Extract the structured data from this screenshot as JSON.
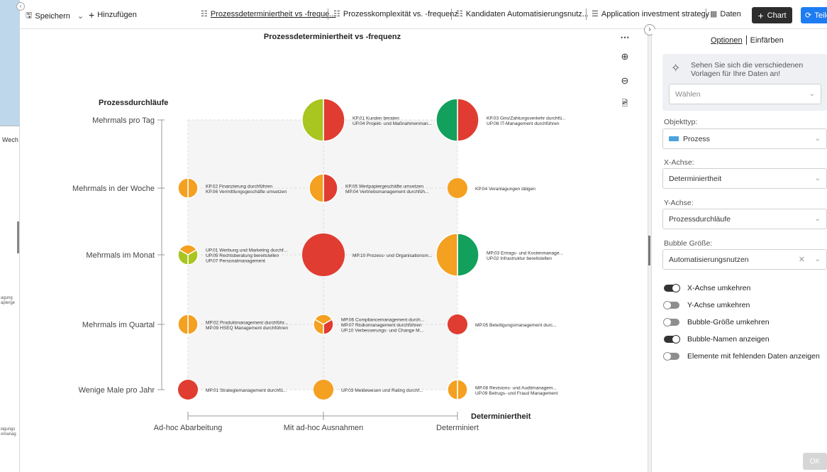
{
  "background_app": {
    "tab_fragment": "Wech",
    "fragments": [
      {
        "lines": [
          "agung",
          "apierge"
        ],
        "top": 0
      },
      {
        "lines": [
          "iligungs",
          "omanag"
        ],
        "top": 0
      }
    ]
  },
  "toolbar": {
    "save_label": "Speichern",
    "add_label": "Hinzufügen",
    "tabs": [
      {
        "label": "Prozessdeterminiertheit vs -freque..."
      },
      {
        "label": "Prozesskomplexität vs. -frequenz"
      },
      {
        "label": "Kandidaten Automatisierungsnutz..."
      },
      {
        "label": "Application investment strategy"
      }
    ],
    "data_label": "Daten",
    "chart_button": "Chart",
    "share_button": "Teilen"
  },
  "chart_data": {
    "type": "bubble",
    "title": "Prozessdeterminiertheit vs -frequenz",
    "ylabel": "Prozessdurchläufe",
    "xlabel": "Determiniertheit",
    "x_categories": [
      "Ad-hoc Abarbeitung",
      "Mit ad-hoc Ausnahmen",
      "Determiniert"
    ],
    "y_categories": [
      "Wenige Male pro Jahr",
      "Mehrmals im Quartal",
      "Mehrmals im Monat",
      "Mehrmals in der Woche",
      "Mehrmals pro Tag"
    ],
    "bubbles": [
      {
        "x": 1,
        "y": 4,
        "size": 3,
        "slices": [
          {
            "color": "#e03c31",
            "value": 1
          },
          {
            "color": "#a8c520",
            "value": 1
          }
        ],
        "labels": [
          "KP.01 Kunden beraten",
          "UP.04 Projekt- und Maßnahmenman..."
        ]
      },
      {
        "x": 2,
        "y": 4,
        "size": 3,
        "slices": [
          {
            "color": "#e03c31",
            "value": 1
          },
          {
            "color": "#12a05c",
            "value": 1
          }
        ],
        "labels": [
          "KP.03 Giro/Zahlungsverkehr durchfü...",
          "UP.08 IT-Management durchführen"
        ]
      },
      {
        "x": 0,
        "y": 3,
        "size": 1,
        "slices": [
          {
            "color": "#f4a020",
            "value": 1
          },
          {
            "color": "#f4a020",
            "value": 1
          }
        ],
        "labels": [
          "KP.02 Finanzierung durchführen",
          "KP.06 Vermittlungsgeschäfte umsetzen"
        ]
      },
      {
        "x": 1,
        "y": 3,
        "size": 2,
        "slices": [
          {
            "color": "#e03c31",
            "value": 1
          },
          {
            "color": "#f4a020",
            "value": 1
          }
        ],
        "labels": [
          "KP.05 Wertpapiergeschäfte umsetzen",
          "MP.04 Vertriebsmanagement durchfüh..."
        ]
      },
      {
        "x": 2,
        "y": 3,
        "size": 1,
        "slices": [
          {
            "color": "#f4a020",
            "value": 1
          }
        ],
        "labels": [
          "KP.04 Veranlagungen tätigen"
        ]
      },
      {
        "x": 0,
        "y": 2,
        "size": 1,
        "slices": [
          {
            "color": "#f4a020",
            "value": 1
          },
          {
            "color": "#a8c520",
            "value": 1
          },
          {
            "color": "#a8c520",
            "value": 1
          }
        ],
        "labels": [
          "UP.01 Werbung und Marketing durchf...",
          "UP.05 Rechtsberatung bereitstellen",
          "UP.07 Personalmanagement"
        ]
      },
      {
        "x": 1,
        "y": 2,
        "size": 3,
        "slices": [
          {
            "color": "#e03c31",
            "value": 1
          }
        ],
        "labels": [
          "MP.10 Prozess- und Organisationsm..."
        ]
      },
      {
        "x": 2,
        "y": 2,
        "size": 3,
        "slices": [
          {
            "color": "#12a05c",
            "value": 1
          },
          {
            "color": "#f4a020",
            "value": 1
          }
        ],
        "labels": [
          "MP.03 Ertrags- und Kostenmanage...",
          "UP.02 Infrastruktur bereitstellen"
        ]
      },
      {
        "x": 0,
        "y": 1,
        "size": 1,
        "slices": [
          {
            "color": "#f4a020",
            "value": 1
          },
          {
            "color": "#f4a020",
            "value": 1
          }
        ],
        "labels": [
          "MP.02 Produktmanagement durchführ...",
          "MP.09 HSEQ Management durchführen"
        ]
      },
      {
        "x": 1,
        "y": 1,
        "size": 1,
        "slices": [
          {
            "color": "#f4a020",
            "value": 1
          },
          {
            "color": "#e03c31",
            "value": 1
          },
          {
            "color": "#f4a020",
            "value": 1
          }
        ],
        "labels": [
          "MP.06 Compliancemanagement durch...",
          "MP.07 Risikomanagement durchführen",
          "UP.10 Verbesserungs- und Change M..."
        ]
      },
      {
        "x": 2,
        "y": 1,
        "size": 1,
        "slices": [
          {
            "color": "#e03c31",
            "value": 1
          }
        ],
        "labels": [
          "MP.05 Beteiligungsmanagement durc..."
        ]
      },
      {
        "x": 0,
        "y": 0,
        "size": 1,
        "slices": [
          {
            "color": "#e03c31",
            "value": 1
          }
        ],
        "labels": [
          "MP.01 Strategiemanagement durchfü..."
        ]
      },
      {
        "x": 1,
        "y": 0,
        "size": 1,
        "slices": [
          {
            "color": "#f4a020",
            "value": 1
          }
        ],
        "labels": [
          "UP.03 Meldewesen und Rating durchf..."
        ]
      },
      {
        "x": 2,
        "y": 0,
        "size": 1,
        "slices": [
          {
            "color": "#f4a020",
            "value": 1
          },
          {
            "color": "#f4a020",
            "value": 1
          }
        ],
        "labels": [
          "MP.08 Revisions- und Auditmanagem...",
          "UP.09 Betrugs- und Fraud Management"
        ]
      }
    ],
    "x_reversed": true,
    "grid_background": "#f5f5f5"
  },
  "side_icons": [
    "more-icon",
    "zoom-in-icon",
    "zoom-out-icon",
    "export-icon"
  ],
  "panel": {
    "tab_options": "Optionen",
    "tab_color": "Einfärben",
    "template_text": "Sehen Sie sich die verschiedenen Vorlagen für Ihre Daten an!",
    "template_select": "Wählen",
    "object_type_label": "Objekttyp:",
    "object_type_value": "Prozess",
    "object_type_color": "#4aa3df",
    "x_axis_label": "X-Achse:",
    "x_axis_value": "Determiniertheit",
    "y_axis_label": "Y-Achse:",
    "y_axis_value": "Prozessdurchläufe",
    "bubble_size_label": "Bubble Größe:",
    "bubble_size_value": "Automatisierungsnutzen",
    "toggles": [
      {
        "label": "X-Achse umkehren",
        "on": true
      },
      {
        "label": "Y-Achse umkehren",
        "on": false
      },
      {
        "label": "Bubble-Größe umkehren",
        "on": false
      },
      {
        "label": "Bubble-Namen anzeigen",
        "on": true
      },
      {
        "label": "Elemente mit fehlenden Daten anzeigen",
        "on": false
      }
    ],
    "ok_button": "OK"
  }
}
